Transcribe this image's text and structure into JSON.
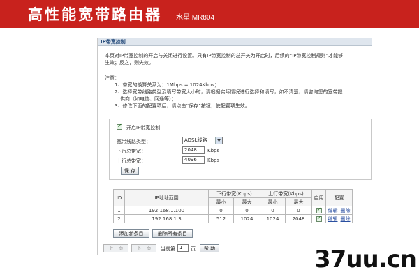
{
  "banner": {
    "title": "高性能宽带路由器",
    "subtitle": "水星 MR804"
  },
  "panel": {
    "title": "IP带宽控制",
    "intro_lines": [
      "本页对IP带宽控制的开启与关闭进行设置。只有IP带宽控制的总开关为开启时，后续的“IP带宽控制规则”才能够",
      "生效；反之，则失效。"
    ],
    "note_label": "注意：",
    "notes": [
      "1、带宽的换算关系为：1Mbps = 1024Kbps；",
      "2、选择宽带线路类型及填写带宽大小时，请根据实际情况进行选择和填写，如不清楚，请咨询您的宽带提",
      "供商（如电信、网通等）；",
      "3、修改下面的配置项后，请点击“保存”按钮，使配置项生效。"
    ]
  },
  "settings": {
    "enable_label": "开启IP带宽控制",
    "enabled": true,
    "line_type_label": "宽带线路类型：",
    "line_type_value": "ADSL线路",
    "down_label": "下行总带宽：",
    "down_value": "2048",
    "up_label": "上行总带宽：",
    "up_value": "4096",
    "unit": "Kbps",
    "save_label": "保 存"
  },
  "rules_table": {
    "headers": {
      "id": "ID",
      "ip_range": "IP地址范围",
      "down": "下行带宽(Kbps)",
      "up": "上行带宽(Kbps)",
      "enable": "启用",
      "config": "配置",
      "min": "最小",
      "max": "最大"
    },
    "rows": [
      {
        "id": "1",
        "ip": "192.168.1.100",
        "down_min": "0",
        "down_max": "0",
        "up_min": "0",
        "up_max": "0",
        "enabled": true,
        "edit": "编辑",
        "delete": "删除"
      },
      {
        "id": "2",
        "ip": "192.168.1.3",
        "down_min": "512",
        "down_max": "1024",
        "up_min": "1024",
        "up_max": "2048",
        "enabled": true,
        "edit": "编辑",
        "delete": "删除"
      }
    ]
  },
  "actions": {
    "add_label": "添加新条目",
    "delete_all_label": "删除所有条目"
  },
  "pager": {
    "prev_label": "上一页",
    "next_label": "下一页",
    "current_prefix": "当前第",
    "current_page": "1",
    "page_suffix": "页",
    "help_label": "帮 助"
  },
  "watermark": {
    "text": "37uu.cn"
  }
}
